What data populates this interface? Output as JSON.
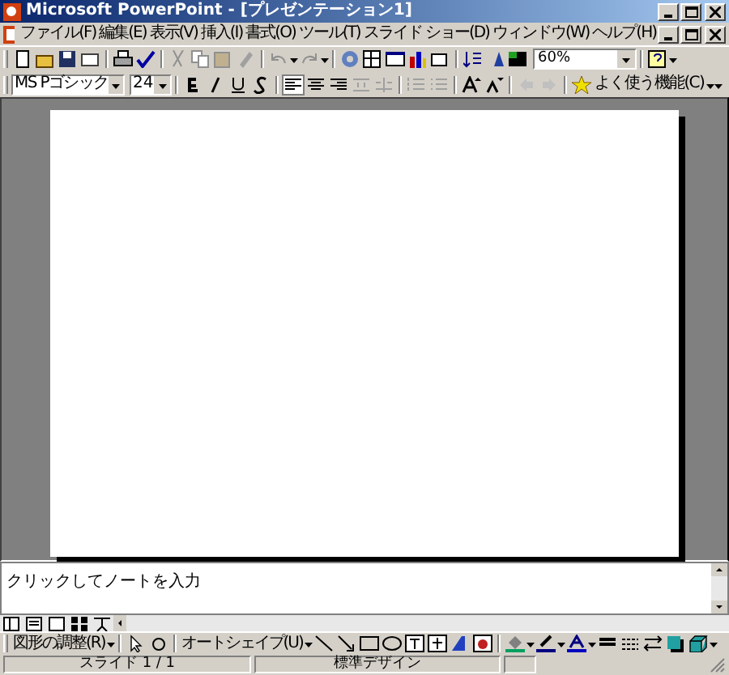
{
  "window": {
    "title": "Microsoft PowerPoint - [プレゼンテーション1]"
  },
  "menu": [
    "ファイル(F)",
    "編集(E)",
    "表示(V)",
    "挿入(I)",
    "書式(O)",
    "ツール(T)",
    "スライド ショー(D)",
    "ウィンドウ(W)",
    "ヘルプ(H)"
  ],
  "standard_toolbar": {
    "zoom": "60%"
  },
  "formatting_toolbar": {
    "font": "MS Pゴシック",
    "size": "24",
    "favorites": "よく使う機能(C)"
  },
  "notes": {
    "placeholder": "クリックしてノートを入力"
  },
  "drawing_toolbar": {
    "draw_menu": "図形の調整(R)",
    "autoshapes": "オートシェイプ(U)"
  },
  "status_bar": [
    "スライド 1 / 1",
    "標準デザイン"
  ]
}
